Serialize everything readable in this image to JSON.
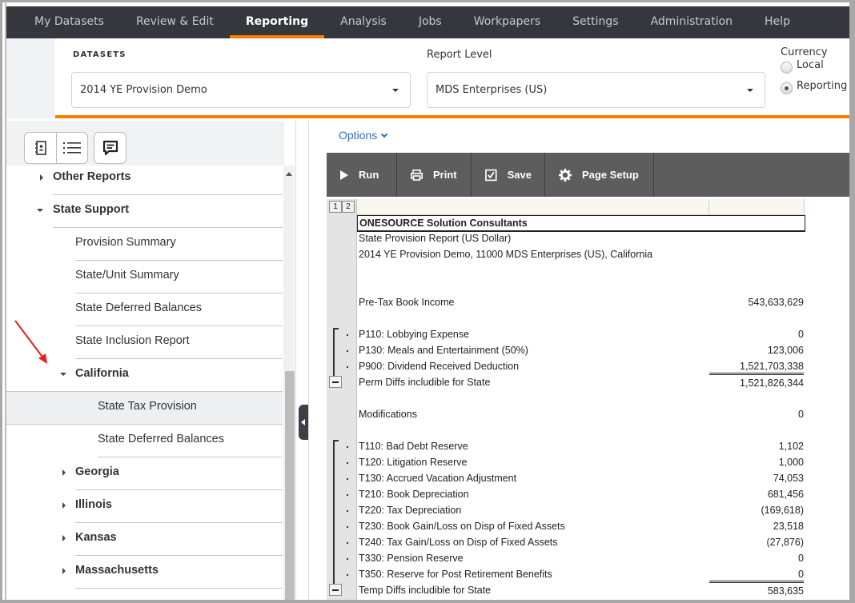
{
  "nav": {
    "items": [
      "My Datasets",
      "Review & Edit",
      "Reporting",
      "Analysis",
      "Jobs",
      "Workpapers",
      "Settings",
      "Administration",
      "Help"
    ],
    "active": "Reporting"
  },
  "selectors": {
    "datasets_label": "DATASETS",
    "dataset_value": "2014 YE Provision Demo",
    "report_level_label": "Report Level",
    "report_level_value": "MDS Enterprises (US)",
    "currency_label": "Currency",
    "currency_options": [
      "Local",
      "Reporting"
    ],
    "currency_selected": "Reporting"
  },
  "sidebar": {
    "toolbar_icons": [
      "address-book-icon",
      "list-icon",
      "comment-icon"
    ],
    "tree": [
      {
        "label": "Other Reports",
        "level": 0,
        "bold": true,
        "toggle": "collapsed"
      },
      {
        "label": "State Support",
        "level": 0,
        "bold": true,
        "toggle": "expanded"
      },
      {
        "label": "Provision Summary",
        "level": 1,
        "bold": false
      },
      {
        "label": "State/Unit Summary",
        "level": 1,
        "bold": false
      },
      {
        "label": "State Deferred Balances",
        "level": 1,
        "bold": false
      },
      {
        "label": "State Inclusion Report",
        "level": 1,
        "bold": false
      },
      {
        "label": "California",
        "level": 1,
        "bold": true,
        "toggle": "expanded"
      },
      {
        "label": "State Tax Provision",
        "level": 2,
        "bold": false,
        "selected": true
      },
      {
        "label": "State Deferred Balances",
        "level": 2,
        "bold": false
      },
      {
        "label": "Georgia",
        "level": 1,
        "bold": true,
        "toggle": "collapsed"
      },
      {
        "label": "Illinois",
        "level": 1,
        "bold": true,
        "toggle": "collapsed"
      },
      {
        "label": "Kansas",
        "level": 1,
        "bold": true,
        "toggle": "collapsed"
      },
      {
        "label": "Massachusetts",
        "level": 1,
        "bold": true,
        "toggle": "collapsed"
      }
    ]
  },
  "report": {
    "options_label": "Options",
    "toolbar": {
      "run": "Run",
      "print": "Print",
      "save": "Save",
      "page_setup": "Page Setup"
    },
    "outline_levels": [
      "1",
      "2"
    ],
    "title": "ONESOURCE Solution Consultants",
    "subtitle": "State Provision Report (US Dollar)",
    "context": "2014 YE Provision Demo, 11000 MDS Enterprises (US), California",
    "pretax": {
      "label": "Pre-Tax Book Income",
      "value": "543,633,629"
    },
    "perm_items": [
      {
        "label": "P110: Lobbying Expense",
        "value": "0"
      },
      {
        "label": "P130: Meals and Entertainment (50%)",
        "value": "123,006"
      },
      {
        "label": "P900: Dividend Received Deduction",
        "value": "1,521,703,338"
      }
    ],
    "perm_total": {
      "label": "Perm Diffs includible for State",
      "value": "1,521,826,344"
    },
    "modifications": {
      "label": "Modifications",
      "value": "0"
    },
    "temp_items": [
      {
        "label": "T110: Bad Debt Reserve",
        "value": "1,102"
      },
      {
        "label": "T120: Litigation Reserve",
        "value": "1,000"
      },
      {
        "label": "T130: Accrued Vacation Adjustment",
        "value": "74,053"
      },
      {
        "label": "T210: Book Depreciation",
        "value": "681,456"
      },
      {
        "label": "T220: Tax Depreciation",
        "value": "(169,618)"
      },
      {
        "label": "T230: Book Gain/Loss on Disp of Fixed Assets",
        "value": "23,518"
      },
      {
        "label": "T240: Tax Gain/Loss on Disp of Fixed Assets",
        "value": "(27,876)"
      },
      {
        "label": "T330: Pension Reserve",
        "value": "0"
      },
      {
        "label": "T350: Reserve for Post Retirement Benefits",
        "value": "0"
      }
    ],
    "temp_total": {
      "label": "Temp Diffs includible for State",
      "value": "583,635"
    }
  },
  "colors": {
    "accent": "#fa7f00",
    "nav_bg": "#36373d",
    "toolbar_bg": "#5d5d5d",
    "link": "#2d72b8",
    "annotation_arrow": "#e8201c"
  }
}
